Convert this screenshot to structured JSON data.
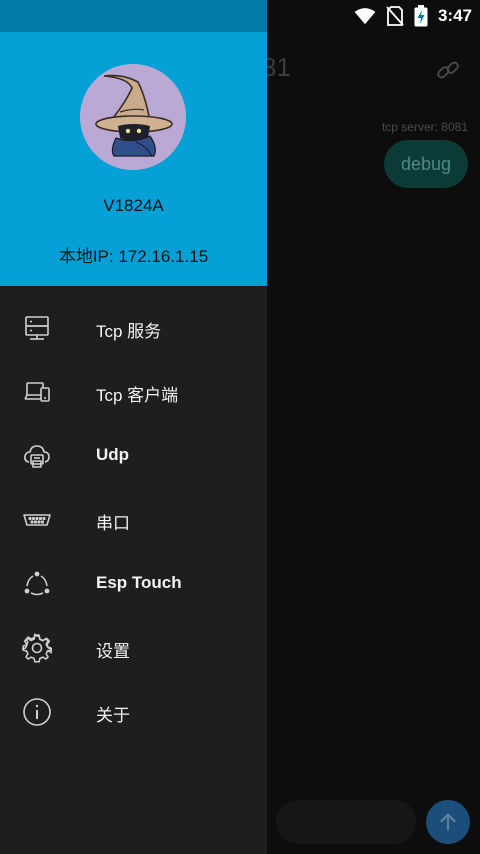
{
  "status_bar": {
    "time": "3:47",
    "icons": [
      "wifi-icon",
      "no-sim-icon",
      "battery-charging-icon"
    ]
  },
  "background": {
    "title_fragment": "31",
    "message_meta": "tcp server: 8081",
    "message_text": "debug",
    "icons": [
      "link-icon",
      "send-arrow-icon"
    ],
    "colors": {
      "bubble": "#0c3a36",
      "send_button": "#1b4e7a"
    }
  },
  "drawer": {
    "device_name": "V1824A",
    "local_ip": "本地IP: 172.16.1.15",
    "header_color": "#04a0d6",
    "items": [
      {
        "label": "Tcp 服务",
        "icon": "server-icon"
      },
      {
        "label": "Tcp 客户端",
        "icon": "devices-icon"
      },
      {
        "label": "Udp",
        "icon": "cloud-printer-icon"
      },
      {
        "label": "串口",
        "icon": "serial-port-icon"
      },
      {
        "label": "Esp Touch",
        "icon": "network-nodes-icon"
      },
      {
        "label": "设置",
        "icon": "gear-icon"
      },
      {
        "label": "关于",
        "icon": "info-icon"
      }
    ]
  }
}
